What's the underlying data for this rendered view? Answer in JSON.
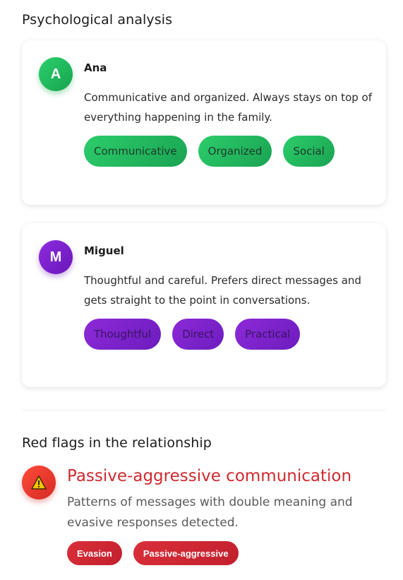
{
  "psychological_analysis": {
    "title": "Psychological analysis",
    "profiles": [
      {
        "initial": "A",
        "name": "Ana",
        "description": "Communicative and organized. Always stays on top of everything happening in the family.",
        "traits": [
          "Communicative",
          "Organized",
          "Social"
        ],
        "color": "#22c062"
      },
      {
        "initial": "M",
        "name": "Miguel",
        "description": "Thoughtful and careful. Prefers direct messages and gets straight to the point in conversations.",
        "traits": [
          "Thoughtful",
          "Direct",
          "Practical"
        ],
        "color": "#7c22cc"
      }
    ]
  },
  "red_flags": {
    "title": "Red flags in the relationship",
    "items": [
      {
        "icon": "warning-icon",
        "title": "Passive-aggressive communication",
        "description": "Patterns of messages with double meaning and evasive responses detected.",
        "tags": [
          "Evasion",
          "Passive-aggressive"
        ],
        "color": "#d42a2f"
      }
    ]
  }
}
